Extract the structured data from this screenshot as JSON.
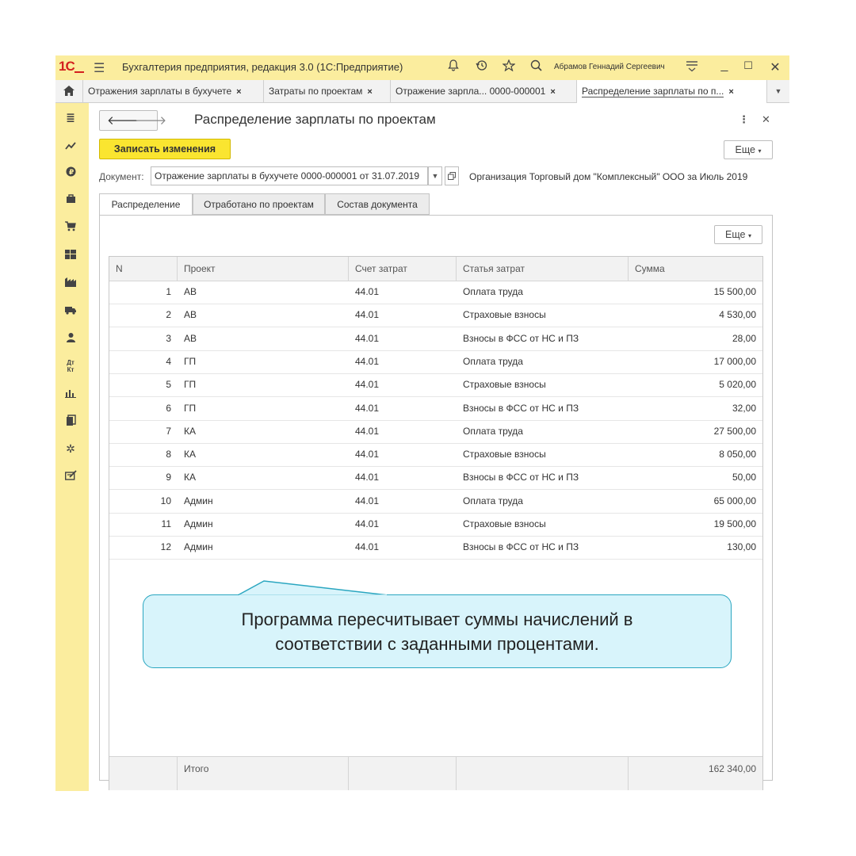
{
  "titlebar": {
    "logo": "1С",
    "title": "Бухгалтерия предприятия, редакция 3.0  (1С:Предприятие)",
    "user": "Абрамов Геннадий Сергеевич",
    "icons": [
      "bell-icon",
      "history-icon",
      "star-icon",
      "search-icon"
    ]
  },
  "tabs": [
    {
      "label": "Отражения зарплаты в бухучете",
      "close": "×"
    },
    {
      "label": "Затраты по проектам",
      "close": "×"
    },
    {
      "label": "Отражение зарпла... 0000-000001",
      "close": "×"
    },
    {
      "label": "Распределение зарплаты по п...",
      "close": "×"
    }
  ],
  "form": {
    "title": "Распределение зарплаты по проектам",
    "save_label": "Записать изменения",
    "more_label": "Еще",
    "doc_label": "Документ:",
    "doc_value": "Отражение зарплаты в бухучете 0000-000001 от 31.07.2019",
    "org_text": "Организация Торговый дом \"Комплексный\" ООО за Июль 2019"
  },
  "form_tabs": [
    "Распределение",
    "Отработано по проектам",
    "Состав документа"
  ],
  "grid": {
    "more_label": "Еще",
    "columns": [
      "N",
      "Проект",
      "Счет затрат",
      "Статья затрат",
      "Сумма"
    ],
    "rows": [
      {
        "n": "1",
        "project": "АВ",
        "account": "44.01",
        "item": "Оплата труда",
        "sum": "15 500,00"
      },
      {
        "n": "2",
        "project": "АВ",
        "account": "44.01",
        "item": "Страховые взносы",
        "sum": "4 530,00"
      },
      {
        "n": "3",
        "project": "АВ",
        "account": "44.01",
        "item": "Взносы в ФСС от НС и ПЗ",
        "sum": "28,00"
      },
      {
        "n": "4",
        "project": "ГП",
        "account": "44.01",
        "item": "Оплата труда",
        "sum": "17 000,00"
      },
      {
        "n": "5",
        "project": "ГП",
        "account": "44.01",
        "item": "Страховые взносы",
        "sum": "5 020,00"
      },
      {
        "n": "6",
        "project": "ГП",
        "account": "44.01",
        "item": "Взносы в ФСС от НС и ПЗ",
        "sum": "32,00"
      },
      {
        "n": "7",
        "project": "КА",
        "account": "44.01",
        "item": "Оплата труда",
        "sum": "27 500,00"
      },
      {
        "n": "8",
        "project": "КА",
        "account": "44.01",
        "item": "Страховые взносы",
        "sum": "8 050,00"
      },
      {
        "n": "9",
        "project": "КА",
        "account": "44.01",
        "item": "Взносы в ФСС от НС и ПЗ",
        "sum": "50,00"
      },
      {
        "n": "10",
        "project": "Админ",
        "account": "44.01",
        "item": "Оплата труда",
        "sum": "65 000,00"
      },
      {
        "n": "11",
        "project": "Админ",
        "account": "44.01",
        "item": "Страховые взносы",
        "sum": "19 500,00"
      },
      {
        "n": "12",
        "project": "Админ",
        "account": "44.01",
        "item": "Взносы в ФСС от НС и ПЗ",
        "sum": "130,00"
      }
    ],
    "footer_label": "Итого",
    "footer_total": "162 340,00"
  },
  "callout": {
    "line1": "Программа пересчитывает суммы начислений в",
    "line2": "соответствии с заданными процентами."
  },
  "colors": {
    "titlebar_bg": "#fbed9e",
    "save_button": "#fae530",
    "callout_bg": "#d8f4fb",
    "callout_border": "#2aa6c0"
  }
}
